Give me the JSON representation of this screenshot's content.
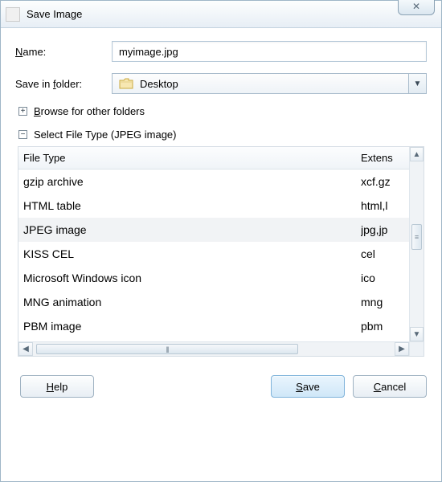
{
  "window": {
    "title": "Save Image",
    "close_glyph": "✕"
  },
  "name": {
    "label_pre": "",
    "label_u": "N",
    "label_post": "ame:",
    "value": "myimage.jpg"
  },
  "folder": {
    "label_pre": "Save in ",
    "label_u": "f",
    "label_post": "older:",
    "value": "Desktop",
    "dd_glyph": "▼"
  },
  "browse": {
    "glyph": "+",
    "pre": "",
    "u": "B",
    "post": "rowse for other folders"
  },
  "filetype_section": {
    "glyph": "−",
    "label": "Select File Type (JPEG image)"
  },
  "columns": {
    "name": "File Type",
    "ext": "Extens"
  },
  "rows": [
    {
      "name": "gzip archive",
      "ext": "xcf.gz",
      "selected": false
    },
    {
      "name": "HTML table",
      "ext": "html,l",
      "selected": false
    },
    {
      "name": "JPEG image",
      "ext": "jpg,jp",
      "selected": true
    },
    {
      "name": "KISS CEL",
      "ext": "cel",
      "selected": false
    },
    {
      "name": "Microsoft Windows icon",
      "ext": "ico",
      "selected": false
    },
    {
      "name": "MNG animation",
      "ext": "mng",
      "selected": false
    },
    {
      "name": "PBM image",
      "ext": "pbm",
      "selected": false
    }
  ],
  "scroll": {
    "up": "▲",
    "down": "▼",
    "left": "◀",
    "right": "▶"
  },
  "buttons": {
    "help_u": "H",
    "help_post": "elp",
    "save_u": "S",
    "save_post": "ave",
    "cancel_u": "C",
    "cancel_post": "ancel"
  }
}
